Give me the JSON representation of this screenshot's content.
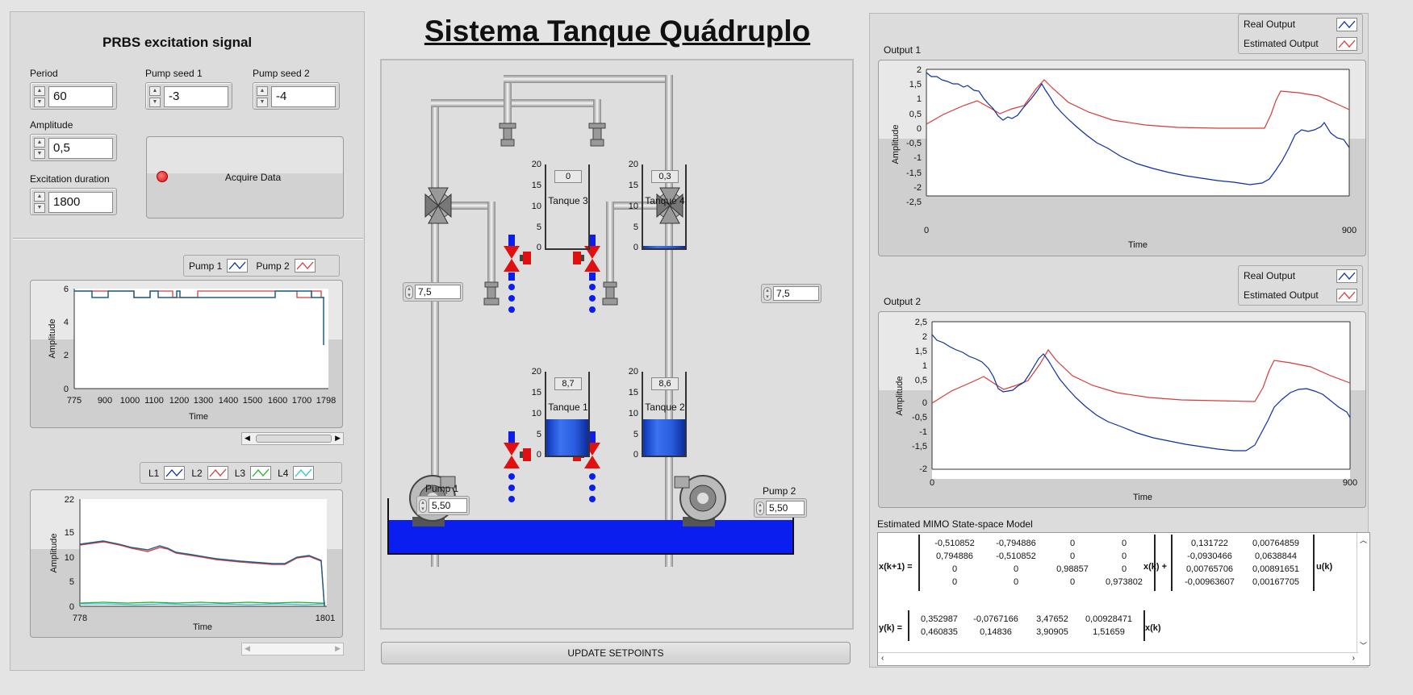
{
  "prbs": {
    "title": "PRBS excitation signal",
    "period": {
      "label": "Period",
      "value": "60"
    },
    "pump_seed_1": {
      "label": "Pump seed 1",
      "value": "-3"
    },
    "pump_seed_2": {
      "label": "Pump seed 2",
      "value": "-4"
    },
    "amplitude": {
      "label": "Amplitude",
      "value": "0,5"
    },
    "excitation_duration": {
      "label": "Excitation duration",
      "value": "1800"
    },
    "acquire_label": "Acquire Data"
  },
  "pump_chart": {
    "legend": [
      "Pump 1",
      "Pump 2"
    ],
    "ylabel": "Amplitude",
    "xlabel": "Time",
    "yticks": [
      "6",
      "4",
      "2",
      "0"
    ],
    "xticks": [
      "775",
      "900",
      "1000",
      "1100",
      "1200",
      "1300",
      "1400",
      "1500",
      "1600",
      "1700",
      "1798"
    ]
  },
  "level_chart": {
    "legend": [
      "L1",
      "L2",
      "L3",
      "L4"
    ],
    "ylabel": "Amplitude",
    "xlabel": "Time",
    "yticks": [
      "22",
      "15",
      "10",
      "5",
      "0"
    ],
    "xticks": [
      "778",
      "1801"
    ]
  },
  "main_title": "Sistema Tanque Quádruplo",
  "tanks": [
    {
      "name": "Tanque 3",
      "value": "0",
      "scale": [
        "20",
        "15",
        "10",
        "5",
        "0"
      ]
    },
    {
      "name": "Tanque 4",
      "value": "0,3",
      "scale": [
        "20",
        "15",
        "10",
        "5",
        "0"
      ]
    },
    {
      "name": "Tanque 1",
      "value": "8,7",
      "scale": [
        "20",
        "15",
        "10",
        "5",
        "0"
      ]
    },
    {
      "name": "Tanque 2",
      "value": "8,6",
      "scale": [
        "20",
        "15",
        "10",
        "5",
        "0"
      ]
    }
  ],
  "tank_levels": [
    0,
    0.3,
    8.7,
    8.6
  ],
  "valve_left_value": "7,5",
  "valve_right_value": "7,5",
  "pump1": {
    "label": "Pump 1",
    "value": "5,50"
  },
  "pump2": {
    "label": "Pump 2",
    "value": "5,50"
  },
  "update_label": "UPDATE SETPOINTS",
  "output1": {
    "title": "Output 1",
    "legend": [
      "Real Output",
      "Estimated Output"
    ],
    "ylabel": "Amplitude",
    "xlabel": "Time",
    "yticks": [
      "2",
      "1,5",
      "1",
      "0,5",
      "0",
      "-0,5",
      "-1",
      "-1,5",
      "-2",
      "-2,5"
    ],
    "xticks": [
      "0",
      "900"
    ]
  },
  "output2": {
    "title": "Output 2",
    "legend": [
      "Real Output",
      "Estimated Output"
    ],
    "ylabel": "Amplitude",
    "xlabel": "Time",
    "yticks": [
      "2,5",
      "2",
      "1,5",
      "1",
      "0,5",
      "0",
      "-0,5",
      "-1",
      "-1,5",
      "-2"
    ],
    "xticks": [
      "0",
      "900"
    ]
  },
  "model": {
    "title": "Estimated MIMO State-space Model",
    "x_next": "x(k+1) =",
    "x_k_plus": "x(k) +",
    "u_k": "u(k)",
    "y_k": "y(k) =",
    "x_k": "x(k)",
    "A": [
      [
        "-0,510852",
        "-0,794886",
        "0",
        "0"
      ],
      [
        "0,794886",
        "-0,510852",
        "0",
        "0"
      ],
      [
        "0",
        "0",
        "0,98857",
        "0"
      ],
      [
        "0",
        "0",
        "0",
        "0,973802"
      ]
    ],
    "B": [
      [
        "0,131722",
        "0,00764859"
      ],
      [
        "-0,0930466",
        "0,0638844"
      ],
      [
        "0,00765706",
        "0,00891651"
      ],
      [
        "-0,00963607",
        "0,00167705"
      ]
    ],
    "C": [
      [
        "0,352987",
        "-0,0767166",
        "3,47652",
        "0,00928471"
      ],
      [
        "0,460835",
        "0,14836",
        "3,90905",
        "1,51659"
      ]
    ]
  },
  "colors": {
    "real": "#0b2fa0",
    "estimated": "#d93a3a",
    "water": "#0a1ef0",
    "tankwater": "#1e50d8"
  }
}
